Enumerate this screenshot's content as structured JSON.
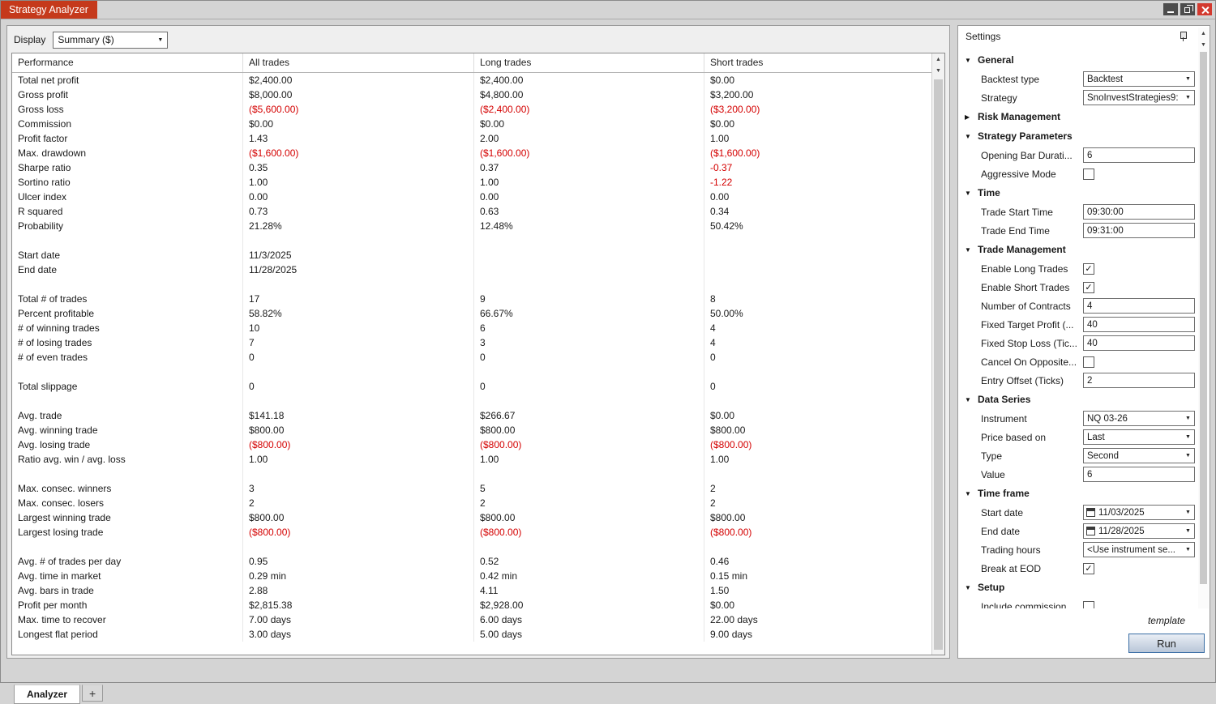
{
  "window": {
    "title": "Strategy Analyzer"
  },
  "colors": {
    "title_tab": "#c5391b",
    "negative_text": "#d40000",
    "close_button": "#d33a2f",
    "run_border": "#3a6ea5"
  },
  "display": {
    "label": "Display",
    "value": "Summary ($)"
  },
  "table": {
    "columns": [
      "Performance",
      "All trades",
      "Long trades",
      "Short trades"
    ],
    "rows": [
      {
        "label": "Total net profit",
        "values": [
          "$2,400.00",
          "$2,400.00",
          "$0.00"
        ]
      },
      {
        "label": "Gross profit",
        "values": [
          "$8,000.00",
          "$4,800.00",
          "$3,200.00"
        ]
      },
      {
        "label": "Gross loss",
        "values": [
          "($5,600.00)",
          "($2,400.00)",
          "($3,200.00)"
        ]
      },
      {
        "label": "Commission",
        "values": [
          "$0.00",
          "$0.00",
          "$0.00"
        ]
      },
      {
        "label": "Profit factor",
        "values": [
          "1.43",
          "2.00",
          "1.00"
        ]
      },
      {
        "label": "Max. drawdown",
        "values": [
          "($1,600.00)",
          "($1,600.00)",
          "($1,600.00)"
        ]
      },
      {
        "label": "Sharpe ratio",
        "values": [
          "0.35",
          "0.37",
          "-0.37"
        ]
      },
      {
        "label": "Sortino ratio",
        "values": [
          "1.00",
          "1.00",
          "-1.22"
        ]
      },
      {
        "label": "Ulcer index",
        "values": [
          "0.00",
          "0.00",
          "0.00"
        ]
      },
      {
        "label": "R squared",
        "values": [
          "0.73",
          "0.63",
          "0.34"
        ]
      },
      {
        "label": "Probability",
        "values": [
          "21.28%",
          "12.48%",
          "50.42%"
        ]
      },
      {
        "label": "",
        "values": [
          "",
          "",
          ""
        ]
      },
      {
        "label": "Start date",
        "values": [
          "11/3/2025",
          "",
          ""
        ]
      },
      {
        "label": "End date",
        "values": [
          "11/28/2025",
          "",
          ""
        ]
      },
      {
        "label": "",
        "values": [
          "",
          "",
          ""
        ]
      },
      {
        "label": "Total # of trades",
        "values": [
          "17",
          "9",
          "8"
        ]
      },
      {
        "label": "Percent profitable",
        "values": [
          "58.82%",
          "66.67%",
          "50.00%"
        ]
      },
      {
        "label": "# of winning trades",
        "values": [
          "10",
          "6",
          "4"
        ]
      },
      {
        "label": "# of losing trades",
        "values": [
          "7",
          "3",
          "4"
        ]
      },
      {
        "label": "# of even trades",
        "values": [
          "0",
          "0",
          "0"
        ]
      },
      {
        "label": "",
        "values": [
          "",
          "",
          ""
        ]
      },
      {
        "label": "Total slippage",
        "values": [
          "0",
          "0",
          "0"
        ]
      },
      {
        "label": "",
        "values": [
          "",
          "",
          ""
        ]
      },
      {
        "label": "Avg. trade",
        "values": [
          "$141.18",
          "$266.67",
          "$0.00"
        ]
      },
      {
        "label": "Avg. winning trade",
        "values": [
          "$800.00",
          "$800.00",
          "$800.00"
        ]
      },
      {
        "label": "Avg. losing trade",
        "values": [
          "($800.00)",
          "($800.00)",
          "($800.00)"
        ]
      },
      {
        "label": "Ratio avg. win / avg. loss",
        "values": [
          "1.00",
          "1.00",
          "1.00"
        ]
      },
      {
        "label": "",
        "values": [
          "",
          "",
          ""
        ]
      },
      {
        "label": "Max. consec. winners",
        "values": [
          "3",
          "5",
          "2"
        ]
      },
      {
        "label": "Max. consec. losers",
        "values": [
          "2",
          "2",
          "2"
        ]
      },
      {
        "label": "Largest winning trade",
        "values": [
          "$800.00",
          "$800.00",
          "$800.00"
        ]
      },
      {
        "label": "Largest losing trade",
        "values": [
          "($800.00)",
          "($800.00)",
          "($800.00)"
        ]
      },
      {
        "label": "",
        "values": [
          "",
          "",
          ""
        ]
      },
      {
        "label": "Avg. # of trades per day",
        "values": [
          "0.95",
          "0.52",
          "0.46"
        ]
      },
      {
        "label": "Avg. time in market",
        "values": [
          "0.29 min",
          "0.42 min",
          "0.15 min"
        ]
      },
      {
        "label": "Avg. bars in trade",
        "values": [
          "2.88",
          "4.11",
          "1.50"
        ]
      },
      {
        "label": "Profit per month",
        "values": [
          "$2,815.38",
          "$2,928.00",
          "$0.00"
        ]
      },
      {
        "label": "Max. time to recover",
        "values": [
          "7.00 days",
          "6.00 days",
          "22.00 days"
        ]
      },
      {
        "label": "Longest flat period",
        "values": [
          "3.00 days",
          "5.00 days",
          "9.00 days"
        ]
      }
    ]
  },
  "tabs": {
    "analyzer": "Analyzer",
    "add": "+"
  },
  "settings": {
    "title": "Settings",
    "sections": [
      {
        "label": "General",
        "expanded": true,
        "items": [
          {
            "label": "Backtest type",
            "control": "select",
            "value": "Backtest"
          },
          {
            "label": "Strategy",
            "control": "select",
            "value": "SnoInvestStrategies9:"
          }
        ]
      },
      {
        "label": "Risk Management",
        "expanded": false,
        "items": []
      },
      {
        "label": "Strategy Parameters",
        "expanded": true,
        "items": [
          {
            "label": "Opening Bar Durati...",
            "control": "input",
            "value": "6"
          },
          {
            "label": "Aggressive Mode",
            "control": "checkbox",
            "checked": false
          }
        ]
      },
      {
        "label": "Time",
        "expanded": true,
        "items": [
          {
            "label": "Trade Start Time",
            "control": "input",
            "value": "09:30:00"
          },
          {
            "label": "Trade End Time",
            "control": "input",
            "value": "09:31:00"
          }
        ]
      },
      {
        "label": "Trade Management",
        "expanded": true,
        "items": [
          {
            "label": "Enable Long Trades",
            "control": "checkbox",
            "checked": true
          },
          {
            "label": "Enable Short Trades",
            "control": "checkbox",
            "checked": true
          },
          {
            "label": "Number of Contracts",
            "control": "input",
            "value": "4"
          },
          {
            "label": "Fixed Target Profit (...",
            "control": "input",
            "value": "40"
          },
          {
            "label": "Fixed Stop Loss (Tic...",
            "control": "input",
            "value": "40"
          },
          {
            "label": "Cancel On Opposite...",
            "control": "checkbox",
            "checked": false
          },
          {
            "label": "Entry Offset (Ticks)",
            "control": "input",
            "value": "2"
          }
        ]
      },
      {
        "label": "Data Series",
        "expanded": true,
        "items": [
          {
            "label": "Instrument",
            "control": "select",
            "value": "NQ 03-26"
          },
          {
            "label": "Price based on",
            "control": "select",
            "value": "Last"
          },
          {
            "label": "Type",
            "control": "select",
            "value": "Second"
          },
          {
            "label": "Value",
            "control": "input",
            "value": "6"
          }
        ]
      },
      {
        "label": "Time frame",
        "expanded": true,
        "items": [
          {
            "label": "Start date",
            "control": "date",
            "value": "11/03/2025"
          },
          {
            "label": "End date",
            "control": "date",
            "value": "11/28/2025"
          },
          {
            "label": "Trading hours",
            "control": "select",
            "value": "<Use instrument se..."
          },
          {
            "label": "Break at EOD",
            "control": "checkbox",
            "checked": true
          }
        ]
      },
      {
        "label": "Setup",
        "expanded": true,
        "items": [
          {
            "label": "Include commission...",
            "control": "checkbox",
            "checked": false
          }
        ]
      }
    ],
    "template_label": "template",
    "run_label": "Run"
  }
}
